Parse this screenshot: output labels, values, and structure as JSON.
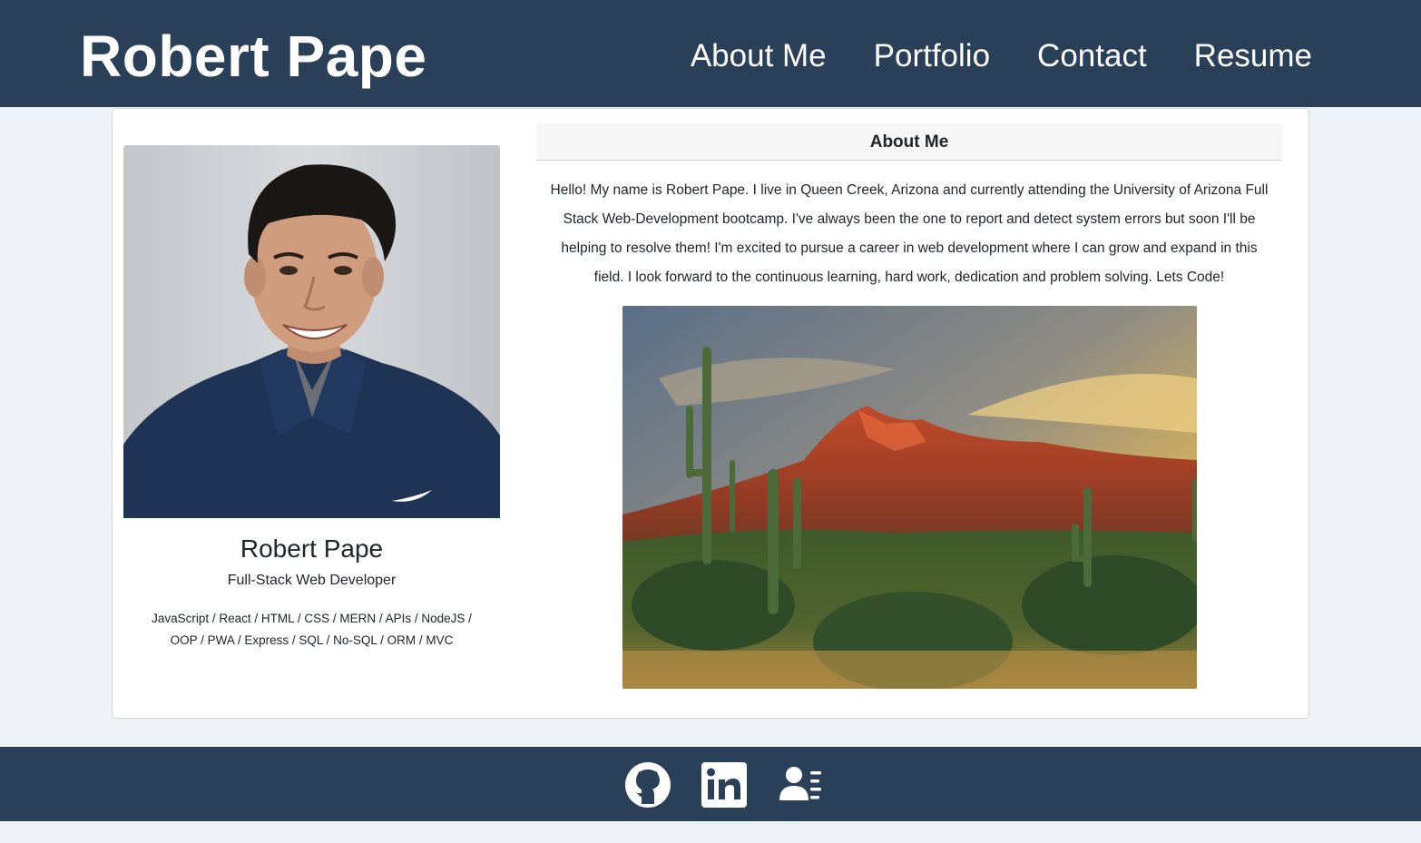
{
  "navbar": {
    "brand": "Robert Pape",
    "links": [
      {
        "label": "About Me"
      },
      {
        "label": "Portfolio"
      },
      {
        "label": "Contact"
      },
      {
        "label": "Resume"
      }
    ]
  },
  "profile": {
    "name": "Robert Pape",
    "title": "Full-Stack Web Developer",
    "skills": "JavaScript / React / HTML / CSS / MERN / APIs / NodeJS / OOP / PWA / Express / SQL / No-SQL / ORM / MVC"
  },
  "about": {
    "heading": "About Me",
    "text": "Hello! My name is Robert Pape. I live in Queen Creek, Arizona and currently attending the University of Arizona Full Stack Web-Development bootcamp. I've always been the one to report and detect system errors but soon I'll be helping to resolve them! I'm excited to pursue a career in web development where I can grow and expand in this field. I look forward to the continuous learning, hard work, dedication and problem solving. Lets Code!"
  },
  "footer": {
    "icons": [
      "github-icon",
      "linkedin-icon",
      "resume-contact-icon"
    ]
  },
  "colors": {
    "navbar_bg": "#2a3f58",
    "page_bg": "#eff2f6",
    "card_bg": "#ffffff"
  }
}
